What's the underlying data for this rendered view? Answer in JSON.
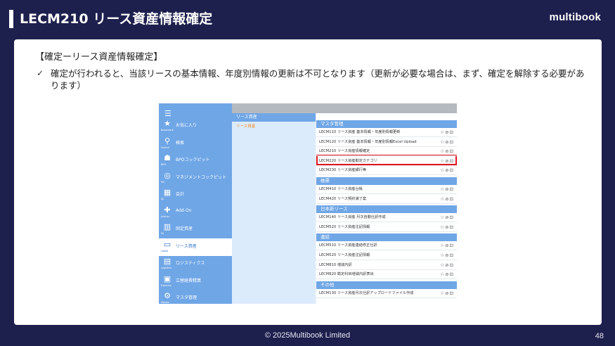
{
  "slide": {
    "title": "LECM210 リース資産情報確定",
    "brand": "multibook",
    "section_title": "【確定ーリース資産情報確定】",
    "bullet": "確定が行われると、当該リースの基本情報、年度別情報の更新は不可となります（更新が必要な場合は、まず、確定を解除する必要があります）",
    "footer": "© 2025Multibook Limited",
    "page_number": "48"
  },
  "app": {
    "sidebar": [
      {
        "icon": "★",
        "icon_name": "star-icon",
        "label": "お気に入り",
        "sub": "Bookmark"
      },
      {
        "icon": "⚲",
        "icon_name": "search-icon",
        "label": "検索",
        "sub": "Search"
      },
      {
        "icon": "☗",
        "icon_name": "people-icon",
        "label": "BPOコックピット",
        "sub": "BPO"
      },
      {
        "icon": "◎",
        "icon_name": "management-icon",
        "label": "マネジメントコックピット",
        "sub": "MC"
      },
      {
        "icon": "▦",
        "icon_name": "calculator-icon",
        "label": "会計",
        "sub": "AC"
      },
      {
        "icon": "✚",
        "icon_name": "addon-icon",
        "label": "Add-On",
        "sub": "Add-on"
      },
      {
        "icon": "▥",
        "icon_name": "building-icon",
        "label": "固定資産",
        "sub": "FA"
      },
      {
        "icon": "▭",
        "icon_name": "lease-icon",
        "label": "リース資産",
        "sub": "Lease",
        "active": true
      },
      {
        "icon": "▤",
        "icon_name": "logistics-icon",
        "label": "ロジスティクス",
        "sub": "Logistics"
      },
      {
        "icon": "▣",
        "icon_name": "briefcase-icon",
        "label": "立替経費精算",
        "sub": "Expense"
      },
      {
        "icon": "⚙",
        "icon_name": "gear-icon",
        "label": "マスタ管理",
        "sub": "Master"
      }
    ],
    "col2_header": "リース資産",
    "col2_item": "リース資産",
    "categories": [
      {
        "name": "マスタ管理",
        "items": [
          "LECM110 リース資産 基本情報・年度別情報更新",
          "LECM120 リース資産 基本情報・年度別情報Excel Upload",
          "LECM210 リース資産情報確定",
          "LECM220 リース資産勘定カテゴリ",
          "LECM230 リース資産銀行等"
        ]
      },
      {
        "name": "帳票",
        "items": [
          "LECM410 リース資産台帳",
          "LECM420 リース契約満了案"
        ]
      },
      {
        "name": "日本新リース",
        "items": [
          "LECM140 リース資産 月次自動仕訳作成",
          "LECM520 リース資産注記情報"
        ]
      },
      {
        "name": "連結",
        "items": [
          "LECM510 リース資産連結修正仕訳",
          "LECM520 リース資産注記情報",
          "LECM810 増減内訳",
          "LECM820 勘定科目増減内訳表出"
        ]
      },
      {
        "name": "その他",
        "items": [
          "LECM130 リース資産月次仕訳アップロードファイル作成"
        ]
      }
    ],
    "row_icons": "☆⊘⊡"
  }
}
